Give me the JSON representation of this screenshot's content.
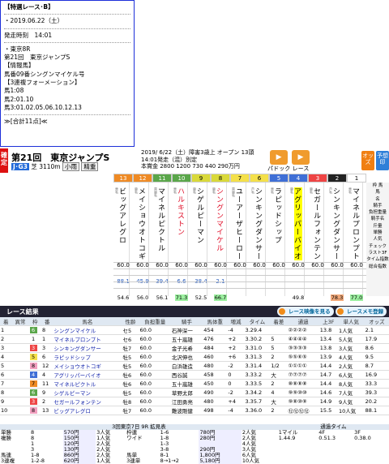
{
  "memo": {
    "lines": [
      "【特選レース･B】",
      "",
      "・2019.06.22（土）",
      "",
      "発走時刻　14:01",
      "",
      "・東京8R",
      "第21回　東京ジャンプS",
      "【情報馬】",
      "馬番09番シングンマイケル号",
      "【3連複フォーメーション】",
      "馬1:08",
      "馬2:01.10",
      "馬3:01.02.05.06.10.12.13",
      "",
      "≫[合計11点]≪"
    ]
  },
  "race": {
    "kaku_label": "確定",
    "title": "第21回　東京ジャンプS",
    "tag": "J･G3",
    "surface": "芝",
    "distance": "3110m",
    "tag2": "小雨",
    "tag3": "精重",
    "info1": "2019/ 6/22（土）障害3歳上 オープン 13頭",
    "info2": "14:01発走（混）別定",
    "info3": "本賞金 2800 1200 730 440 290万円",
    "btn_paddock": "パドック",
    "btn_race": "レース",
    "btn_odds": "オッズ",
    "btn_yoso": "予想印"
  },
  "horses": [
    {
      "waku": "8",
      "ban": "13",
      "name": "ビッグアレグロ",
      "wt": "60.0",
      "od": "88.1",
      "od2": "54.6",
      "sub": "栗毛",
      "wcol": "#ef8a24"
    },
    {
      "waku": "8",
      "ban": "12",
      "name": "メイショウオトコギ",
      "wt": "60.0",
      "od": "45.9",
      "od2": "56.0",
      "sub": "鹿毛",
      "wcol": "#ef8a24"
    },
    {
      "waku": "7",
      "ban": "11",
      "name": "マイネルピクトル",
      "wt": "60.0",
      "od": "39.4",
      "od2": "56.1",
      "sub": "黒鹿毛",
      "wcol": "#5aa64a"
    },
    {
      "waku": "7",
      "ban": "10",
      "name": "ハルキストン",
      "wt": "60.0",
      "od": "6.6",
      "od2": "71.3",
      "sub": "栗毛",
      "wcol": "#5aa64a",
      "red": true
    },
    {
      "waku": "6",
      "ban": "9",
      "name": "シゲルピーマン",
      "wt": "60.0",
      "od": "38.4",
      "od2": "52.5",
      "sub": "鹿毛",
      "wcol": "#d9d93a"
    },
    {
      "waku": "6",
      "ban": "8",
      "name": "シングンマイケル",
      "wt": "60.0",
      "od": "2.1",
      "od2": "66.7",
      "sub": "鹿毛",
      "wcol": "#d9d93a",
      "red": true
    },
    {
      "waku": "5",
      "ban": "7",
      "name": "ユーアーザヒーロー",
      "wt": "60.0",
      "od": "",
      "od2": "",
      "sub": "黒鹿毛",
      "wcol": "#f4e04a"
    },
    {
      "waku": "5",
      "ban": "6",
      "name": "シンキングダンサー",
      "wt": "60.0",
      "od": "",
      "od2": "",
      "sub": "芦毛",
      "wcol": "#f4e04a"
    },
    {
      "waku": "4",
      "ban": "5",
      "name": "ラピッドシップ",
      "wt": "60.0",
      "od": "",
      "od2": "",
      "sub": "栗毛",
      "wcol": "#3f6fd6"
    },
    {
      "waku": "4",
      "ban": "4",
      "name": "アグリッパーバイオ",
      "wt": "60.0",
      "od": "",
      "od2": "49.8",
      "sub": "鹿毛",
      "wcol": "#3f6fd6",
      "yel": true
    },
    {
      "waku": "3",
      "ban": "3",
      "name": "セガールフォンテン",
      "wt": "60.0",
      "od": "",
      "od2": "",
      "sub": "鹿毛",
      "wcol": "#e44"
    },
    {
      "waku": "2",
      "ban": "2",
      "name": "シンキングダンサー",
      "wt": "60.0",
      "od": "",
      "od2": "78.3",
      "sub": "芦毛",
      "wcol": "#222"
    },
    {
      "waku": "1",
      "ban": "1",
      "name": "マイネルプロンプト",
      "wt": "60.0",
      "od": "",
      "od2": "77.0",
      "sub": "栗毛",
      "wcol": "#fff"
    }
  ],
  "row_labels": [
    "枠 馬",
    "馬",
    "名",
    "",
    "",
    "",
    "",
    "騎手",
    "負担重量",
    "騎手名",
    "斤量",
    "単勝",
    "人気",
    "チェック",
    "ラスト3F",
    "タイム指数",
    "総合指数"
  ],
  "results": {
    "header": "レース結果",
    "btn_video": "レース映像を見る",
    "btn_memo": "レースメモ登録",
    "cols": [
      "着",
      "異常",
      "枠",
      "番",
      "馬名",
      "性齢",
      "負担重量",
      "騎手",
      "馬体重",
      "増減",
      "タイム",
      "着差",
      "通過",
      "上3F",
      "単人気",
      "オッズ"
    ],
    "rows": [
      [
        "1",
        "",
        "6",
        "8",
        "シングンマイケル",
        "セ5",
        "60.0",
        "石神深一",
        "454",
        "-4",
        "3.29.4",
        "",
        "②②②②",
        "13.8",
        "1人気",
        "2.1"
      ],
      [
        "2",
        "",
        "1",
        "1",
        "マイネルプロンプト",
        "セ6",
        "60.0",
        "五十嵐雄",
        "476",
        "+2",
        "3.30.2",
        "5",
        "④④④④",
        "13.4",
        "5人気",
        "17.9"
      ],
      [
        "3",
        "",
        "3",
        "3",
        "シンキングダンサー",
        "牡7",
        "60.0",
        "金子光希",
        "484",
        "+2",
        "3.31.0",
        "5",
        "③③③③",
        "13.8",
        "3人気",
        "8.6"
      ],
      [
        "4",
        "",
        "5",
        "6",
        "ラピッドシップ",
        "牡5",
        "60.0",
        "北沢伸也",
        "460",
        "+6",
        "3.31.3",
        "2",
        "⑤⑤⑥⑤",
        "13.9",
        "4人気",
        "9.5"
      ],
      [
        "5",
        "",
        "8",
        "12",
        "メイショウオトコギ",
        "牡5",
        "60.0",
        "白浜雄造",
        "480",
        "-2",
        "3.31.4",
        "1/2",
        "①①①①",
        "14.4",
        "2人気",
        "8.7"
      ],
      [
        "6",
        "",
        "4",
        "4",
        "アグリッパーバイオ",
        "牡6",
        "60.0",
        "西谷誠",
        "458",
        "0",
        "3.33.2",
        "大",
        "⑦⑦⑦⑦",
        "14.7",
        "6人気",
        "16.9"
      ],
      [
        "7",
        "",
        "7",
        "11",
        "マイネルピクトル",
        "牡6",
        "60.0",
        "五十嵐雄",
        "450",
        "0",
        "3.33.5",
        "2",
        "⑧⑧⑧⑧",
        "14.4",
        "8人気",
        "33.3"
      ],
      [
        "8",
        "",
        "6",
        "9",
        "シゲルピーマン",
        "牡5",
        "60.0",
        "草野太郎",
        "490",
        "-2",
        "3.34.2",
        "4",
        "⑨⑨⑩⑩",
        "14.6",
        "7人気",
        "39.3"
      ],
      [
        "9",
        "",
        "3",
        "2",
        "セガールフォンテン",
        "牡8",
        "60.0",
        "江田勇亮",
        "480",
        "+4",
        "3.35.7",
        "大",
        "⑨⑧⑩⑨",
        "14.9",
        "9人気",
        "20.2"
      ],
      [
        "10",
        "",
        "8",
        "13",
        "ビッグアレグロ",
        "牡7",
        "60.0",
        "難波剛健",
        "498",
        "-4",
        "3.36.0",
        "2",
        "⑫⑫⑫⑫",
        "15.5",
        "10人気",
        "88.1"
      ]
    ]
  },
  "payout": {
    "header": "3回東京7日 9R 拡見表",
    "tsuuka": "通過タイム",
    "rows": [
      [
        "単勝",
        "8",
        "",
        "570円",
        "3人気",
        "枠連",
        "1-6",
        "780円",
        "2人気"
      ],
      [
        "複勝",
        "8",
        "",
        "150円",
        "1人気",
        "ワイド",
        "1-8",
        "280円",
        "2人気"
      ],
      [
        "",
        "1",
        "",
        "120円",
        "2人気",
        "",
        "1-3",
        "",
        "4人気"
      ],
      [
        "",
        "3",
        "",
        "130円",
        "2人気",
        "",
        "3-8",
        "290円",
        "3人気"
      ],
      [
        "馬連",
        "1-8",
        "",
        "860円",
        "2人気",
        "馬単",
        "8-1",
        "1,800円",
        "6人気"
      ],
      [
        "3連複",
        "1-2-8",
        "",
        "620円",
        "1人気",
        "3連単",
        "8→1→2",
        "5,180円",
        "10人気"
      ]
    ],
    "t_labels": [
      "1マイル",
      "4F",
      "3F"
    ],
    "t_vals": [
      "1.44.9",
      "0.51.3",
      "0.38.0"
    ]
  }
}
